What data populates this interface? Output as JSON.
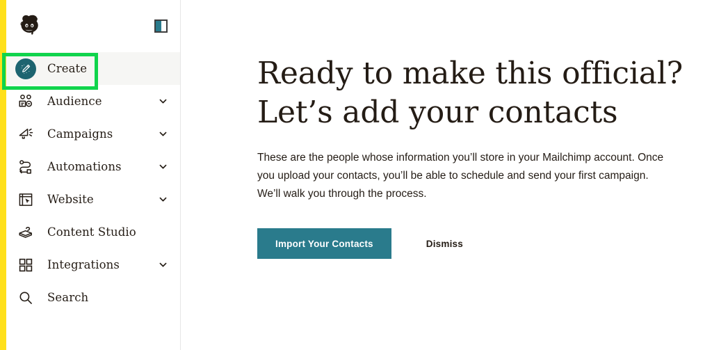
{
  "brand": {
    "logo_name": "mailchimp-freddie-logo",
    "yellow": "#ffe01b",
    "teal": "#2a7b8c",
    "dark_teal": "#1d6470",
    "annotation_green": "#10d44c"
  },
  "sidebar": {
    "panel_toggle_name": "collapse-sidebar-icon",
    "items": [
      {
        "label": "Create",
        "icon": "magic-pencil-icon",
        "expandable": false,
        "active": true
      },
      {
        "label": "Audience",
        "icon": "contacts-icon",
        "expandable": true,
        "active": false
      },
      {
        "label": "Campaigns",
        "icon": "megaphone-icon",
        "expandable": true,
        "active": false
      },
      {
        "label": "Automations",
        "icon": "flow-path-icon",
        "expandable": true,
        "active": false
      },
      {
        "label": "Website",
        "icon": "browser-cursor-icon",
        "expandable": true,
        "active": false
      },
      {
        "label": "Content Studio",
        "icon": "camera-icon",
        "expandable": false,
        "active": false
      },
      {
        "label": "Integrations",
        "icon": "grid-squares-icon",
        "expandable": true,
        "active": false
      },
      {
        "label": "Search",
        "icon": "search-icon",
        "expandable": false,
        "active": false
      }
    ]
  },
  "main": {
    "title_line1": "Ready to make this official?",
    "title_line2": "Let’s add your contacts",
    "body": "These are the people whose information you’ll store in your Mailchimp account. Once you upload your contacts, you’ll be able to schedule and send your first campaign. We’ll walk you through the process.",
    "primary_button": "Import Your Contacts",
    "dismiss_button": "Dismiss"
  }
}
